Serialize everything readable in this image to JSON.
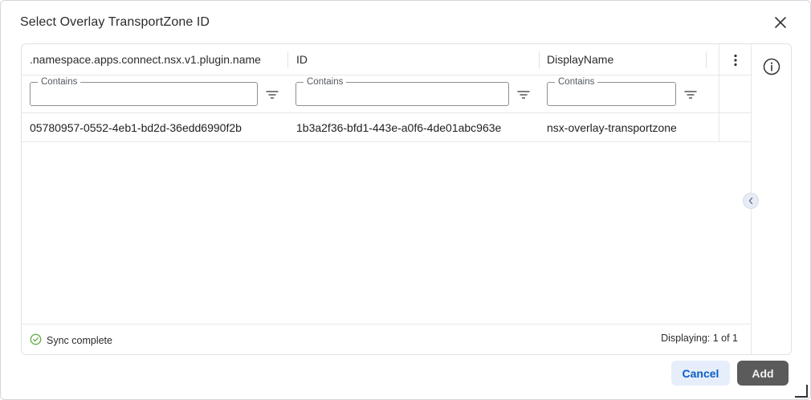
{
  "dialog": {
    "title": "Select Overlay TransportZone ID",
    "close_icon": "close-icon"
  },
  "grid": {
    "columns": [
      {
        "label": ".namespace.apps.connect.nsx.v1.plugin.name"
      },
      {
        "label": "ID"
      },
      {
        "label": "DisplayName"
      }
    ],
    "menu_icon": "kebab-menu-icon",
    "filters": [
      {
        "legend": "Contains",
        "value": "",
        "icon": "filter-icon"
      },
      {
        "legend": "Contains",
        "value": "",
        "icon": "filter-icon"
      },
      {
        "legend": "Contains",
        "value": "",
        "icon": "filter-icon"
      }
    ],
    "rows": [
      {
        "name": "05780957-0552-4eb1-bd2d-36edd6990f2b",
        "id": "1b3a2f36-bfd1-443e-a0f6-4de01abc963e",
        "display_name": "nsx-overlay-transportzone"
      }
    ],
    "footer": {
      "sync_status": "Sync complete",
      "sync_icon": "check-circle-icon",
      "displaying": "Displaying: 1 of 1"
    }
  },
  "side_panel": {
    "info_icon": "info-icon",
    "collapse_icon": "chevron-left-icon"
  },
  "actions": {
    "cancel_label": "Cancel",
    "add_label": "Add"
  },
  "colors": {
    "accent": "#0a5cc7",
    "success": "#6ab04c",
    "add_button": "#5b5b5b"
  }
}
